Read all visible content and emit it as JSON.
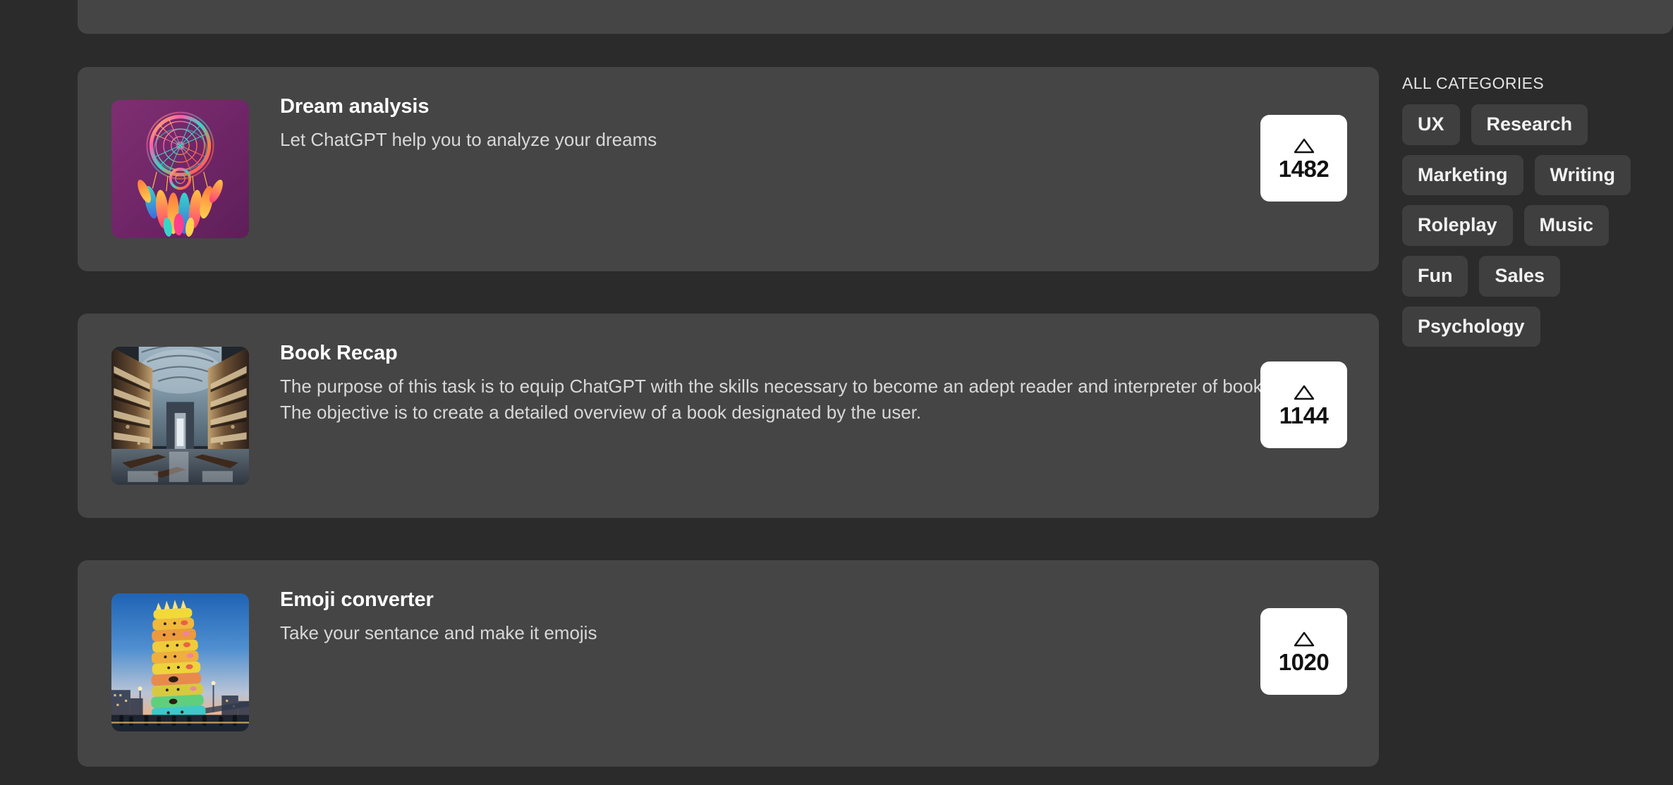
{
  "theme": {
    "page_bg": "#2b2b2b",
    "card_bg": "#454545",
    "chip_bg": "#3f3f3f",
    "vote_bg": "#ffffff",
    "title_color": "#ffffff",
    "desc_color": "#d8d8d8"
  },
  "prompts": [
    {
      "title": "Dream analysis",
      "description": "Let ChatGPT help you to analyze your dreams",
      "votes": "1482",
      "thumbnail": "dreamcatcher-artwork-thumbnail",
      "vote_icon": "triangle-up-icon"
    },
    {
      "title": "Book Recap",
      "description": "The purpose of this task is to equip ChatGPT with the skills necessary to become an adept reader and interpreter of books. The objective is to create a detailed overview of a book designated by the user.",
      "votes": "1144",
      "thumbnail": "library-interior-thumbnail",
      "vote_icon": "triangle-up-icon"
    },
    {
      "title": "Emoji converter",
      "description": "Take your sentance and make it emojis",
      "votes": "1020",
      "thumbnail": "emoji-tower-thumbnail",
      "vote_icon": "triangle-up-icon"
    }
  ],
  "sidebar": {
    "heading": "ALL CATEGORIES",
    "categories": [
      {
        "label": "UX"
      },
      {
        "label": "Research"
      },
      {
        "label": "Marketing"
      },
      {
        "label": "Writing"
      },
      {
        "label": "Roleplay"
      },
      {
        "label": "Music"
      },
      {
        "label": "Fun"
      },
      {
        "label": "Sales"
      },
      {
        "label": "Psychology"
      }
    ]
  }
}
